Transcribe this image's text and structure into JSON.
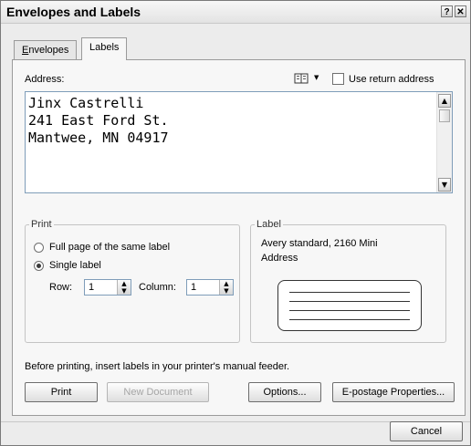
{
  "dialog": {
    "title": "Envelopes and Labels",
    "help_glyph": "?",
    "close_glyph": "✕"
  },
  "tabs": [
    {
      "label": "Envelopes",
      "active": false
    },
    {
      "label": "Labels",
      "active": true
    }
  ],
  "address": {
    "label": "Address:",
    "lines": [
      "Jinx Castrelli",
      "241 East Ford St.",
      "Mantwee, MN 04917"
    ],
    "use_return_label": "Use return address",
    "use_return_checked": false,
    "address_book_icon": "address-book-icon",
    "dropdown_glyph": "▼"
  },
  "print_group": {
    "legend": "Print",
    "full_page_label": "Full page of the same label",
    "single_label": "Single label",
    "selected": "single",
    "row_label": "Row:",
    "row_value": "1",
    "column_label": "Column:",
    "column_value": "1"
  },
  "label_group": {
    "legend": "Label",
    "line1": "Avery standard, 2160 Mini",
    "line2": "Address"
  },
  "info_text": "Before printing, insert labels in your printer's manual feeder.",
  "buttons": {
    "print": "Print",
    "new_document": "New Document",
    "options": "Options...",
    "epostage": "E-postage Properties...",
    "cancel": "Cancel"
  }
}
